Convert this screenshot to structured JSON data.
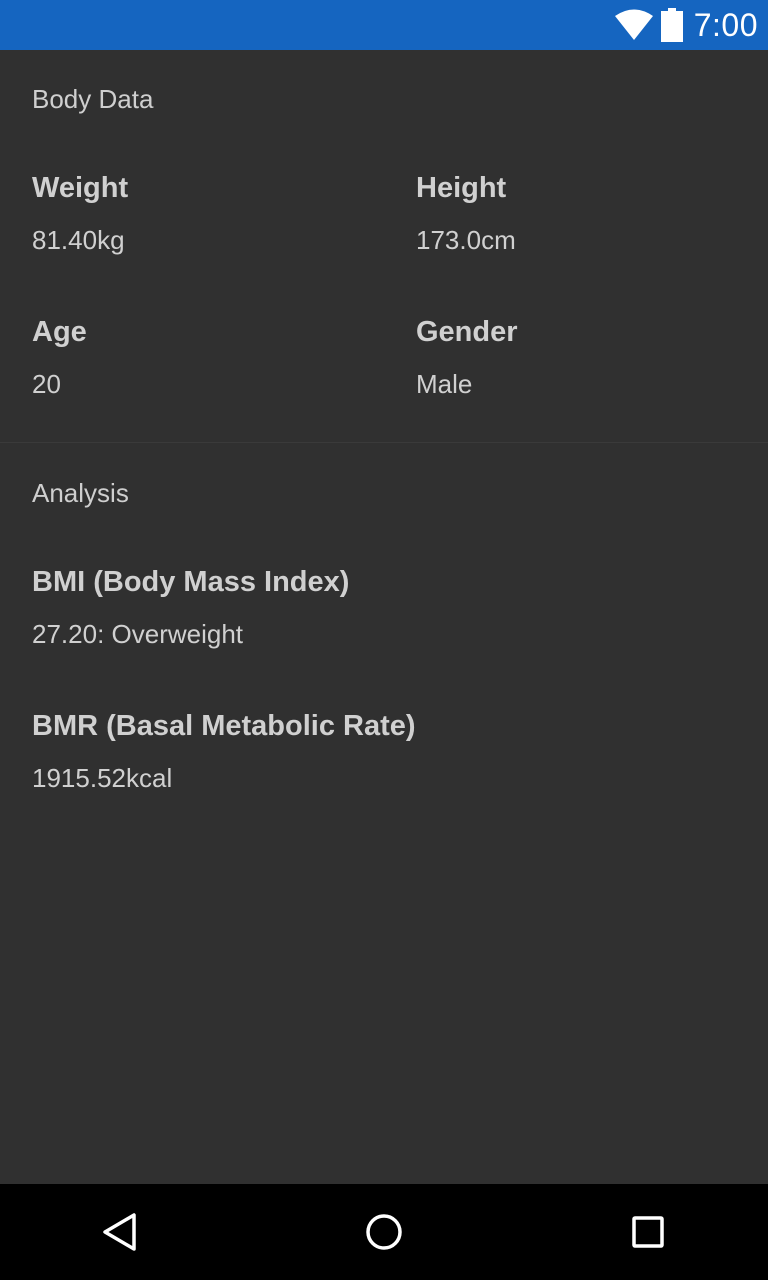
{
  "status_bar": {
    "time": "7:00",
    "color": "#1565c0"
  },
  "body_data": {
    "section_title": "Body Data",
    "weight": {
      "label": "Weight",
      "value": "81.40kg"
    },
    "height": {
      "label": "Height",
      "value": "173.0cm"
    },
    "age": {
      "label": "Age",
      "value": "20"
    },
    "gender": {
      "label": "Gender",
      "value": "Male"
    }
  },
  "analysis": {
    "section_title": "Analysis",
    "bmi": {
      "label": "BMI (Body Mass Index)",
      "value": "27.20: Overweight"
    },
    "bmr": {
      "label": "BMR (Basal Metabolic Rate)",
      "value": "1915.52kcal"
    }
  },
  "nav_bar": {
    "icons": [
      "back-icon",
      "home-icon",
      "recents-icon"
    ]
  }
}
